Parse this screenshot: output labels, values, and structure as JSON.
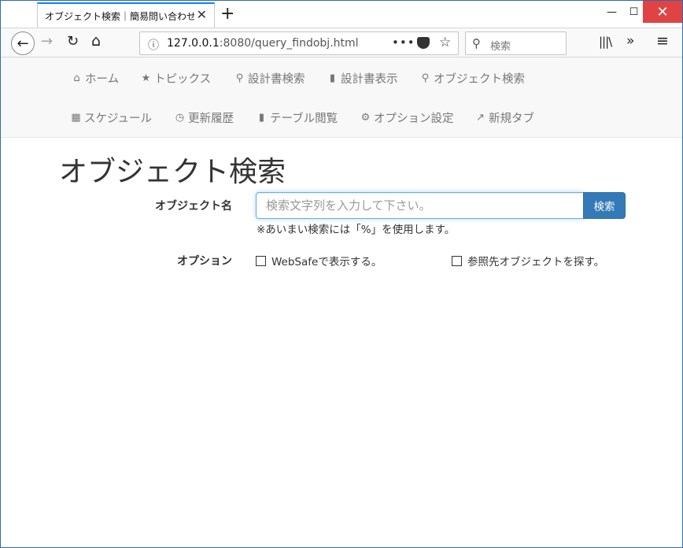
{
  "browser": {
    "tab_title": "オブジェクト検索｜簡易問い合わせサイト",
    "tab_close": "✕",
    "new_tab": "+",
    "win_minimize": "—",
    "win_maximize": "☐",
    "win_close": "✕",
    "url_host": "127.0.0.1",
    "url_path": ":8080/query_findobj.html",
    "search_placeholder": "検索",
    "icons": {
      "back": "back-arrow-icon",
      "forward": "forward-arrow-icon",
      "reload": "reload-icon",
      "home": "home-icon",
      "info": "info-icon",
      "more": "more-icon",
      "pocket": "pocket-icon",
      "bookmark": "star-icon",
      "search": "search-icon",
      "library": "library-icon",
      "overflow": "overflow-icon",
      "menu": "hamburger-menu-icon"
    }
  },
  "nav": {
    "items": [
      {
        "label": "ホーム",
        "icon": "home-icon"
      },
      {
        "label": "トピックス",
        "icon": "star-icon"
      },
      {
        "label": "設計書検索",
        "icon": "search-icon"
      },
      {
        "label": "設計書表示",
        "icon": "book-icon"
      },
      {
        "label": "オブジェクト検索",
        "icon": "search-icon"
      },
      {
        "label": "スケジュール",
        "icon": "calendar-icon"
      },
      {
        "label": "更新履歴",
        "icon": "clock-icon"
      },
      {
        "label": "テーブル閲覧",
        "icon": "book-icon"
      },
      {
        "label": "オプション設定",
        "icon": "gear-icon"
      },
      {
        "label": "新規タブ",
        "icon": "external-link-icon"
      }
    ]
  },
  "main": {
    "title": "オブジェクト検索",
    "object_label": "オブジェクト名",
    "object_placeholder": "検索文字列を入力して下さい。",
    "search_button": "検索",
    "hint": "※あいまい検索には「%」を使用します。",
    "options_label": "オプション",
    "options": [
      {
        "label": "WebSafeで表示する。",
        "checked": false
      },
      {
        "label": "参照先オブジェクトを探す。",
        "checked": false
      }
    ]
  },
  "colors": {
    "accent": "#337ab7",
    "focus": "#66afe9",
    "close": "#e04343"
  }
}
